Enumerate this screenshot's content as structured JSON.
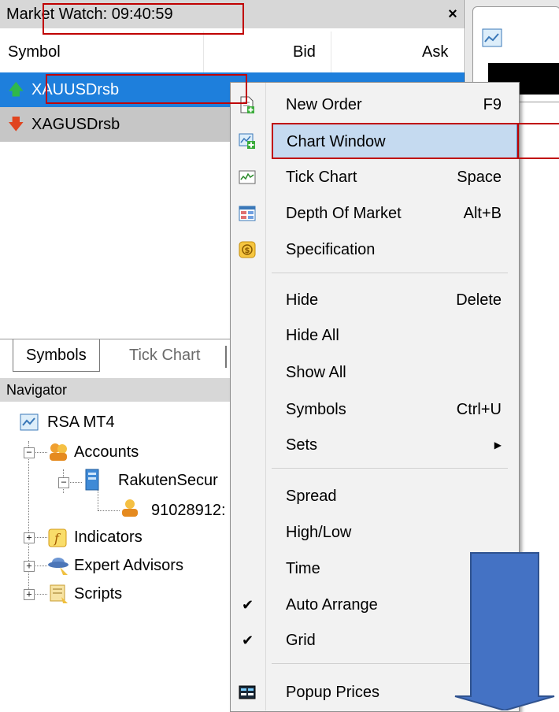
{
  "market_watch": {
    "title": "Market Watch: 09:40:59",
    "close": "×",
    "columns": [
      "Symbol",
      "Bid",
      "Ask"
    ],
    "rows": [
      {
        "symbol": "XAUUSDrsb",
        "direction": "up"
      },
      {
        "symbol": "XAGUSDrsb",
        "direction": "down"
      }
    ],
    "tabs": [
      "Symbols",
      "Tick Chart"
    ]
  },
  "navigator": {
    "title": "Navigator",
    "root": "RSA MT4",
    "accounts": "Accounts",
    "broker": "RakutenSecur",
    "account_number": "91028912:",
    "indicators": "Indicators",
    "experts": "Expert Advisors",
    "scripts": "Scripts"
  },
  "context_menu": {
    "items": [
      {
        "label": "New Order",
        "key": "F9",
        "icon": "new-order-icon"
      },
      {
        "label": "Chart Window",
        "key": "",
        "icon": "chart-window-icon",
        "highlighted": true
      },
      {
        "label": "Tick Chart",
        "key": "Space",
        "icon": "tick-chart-icon"
      },
      {
        "label": "Depth Of Market",
        "key": "Alt+B",
        "icon": "depth-of-market-icon"
      },
      {
        "label": "Specification",
        "key": "",
        "icon": "specification-icon"
      },
      {
        "label": "Hide",
        "key": "Delete"
      },
      {
        "label": "Hide All",
        "key": ""
      },
      {
        "label": "Show All",
        "key": ""
      },
      {
        "label": "Symbols",
        "key": "Ctrl+U"
      },
      {
        "label": "Sets",
        "key": "",
        "submenu": true
      },
      {
        "label": "Spread",
        "key": ""
      },
      {
        "label": "High/Low",
        "key": ""
      },
      {
        "label": "Time",
        "key": ""
      },
      {
        "label": "Auto Arrange",
        "key": "",
        "checked": true
      },
      {
        "label": "Grid",
        "key": "",
        "checked": true
      },
      {
        "label": "Popup Prices",
        "key": "",
        "icon": "popup-prices-icon"
      }
    ]
  },
  "colors": {
    "selection": "#1e7fdc",
    "annotation_red": "#c00000",
    "annotation_arrow": "#4472c4",
    "menu_highlight": "#c5daf0"
  }
}
